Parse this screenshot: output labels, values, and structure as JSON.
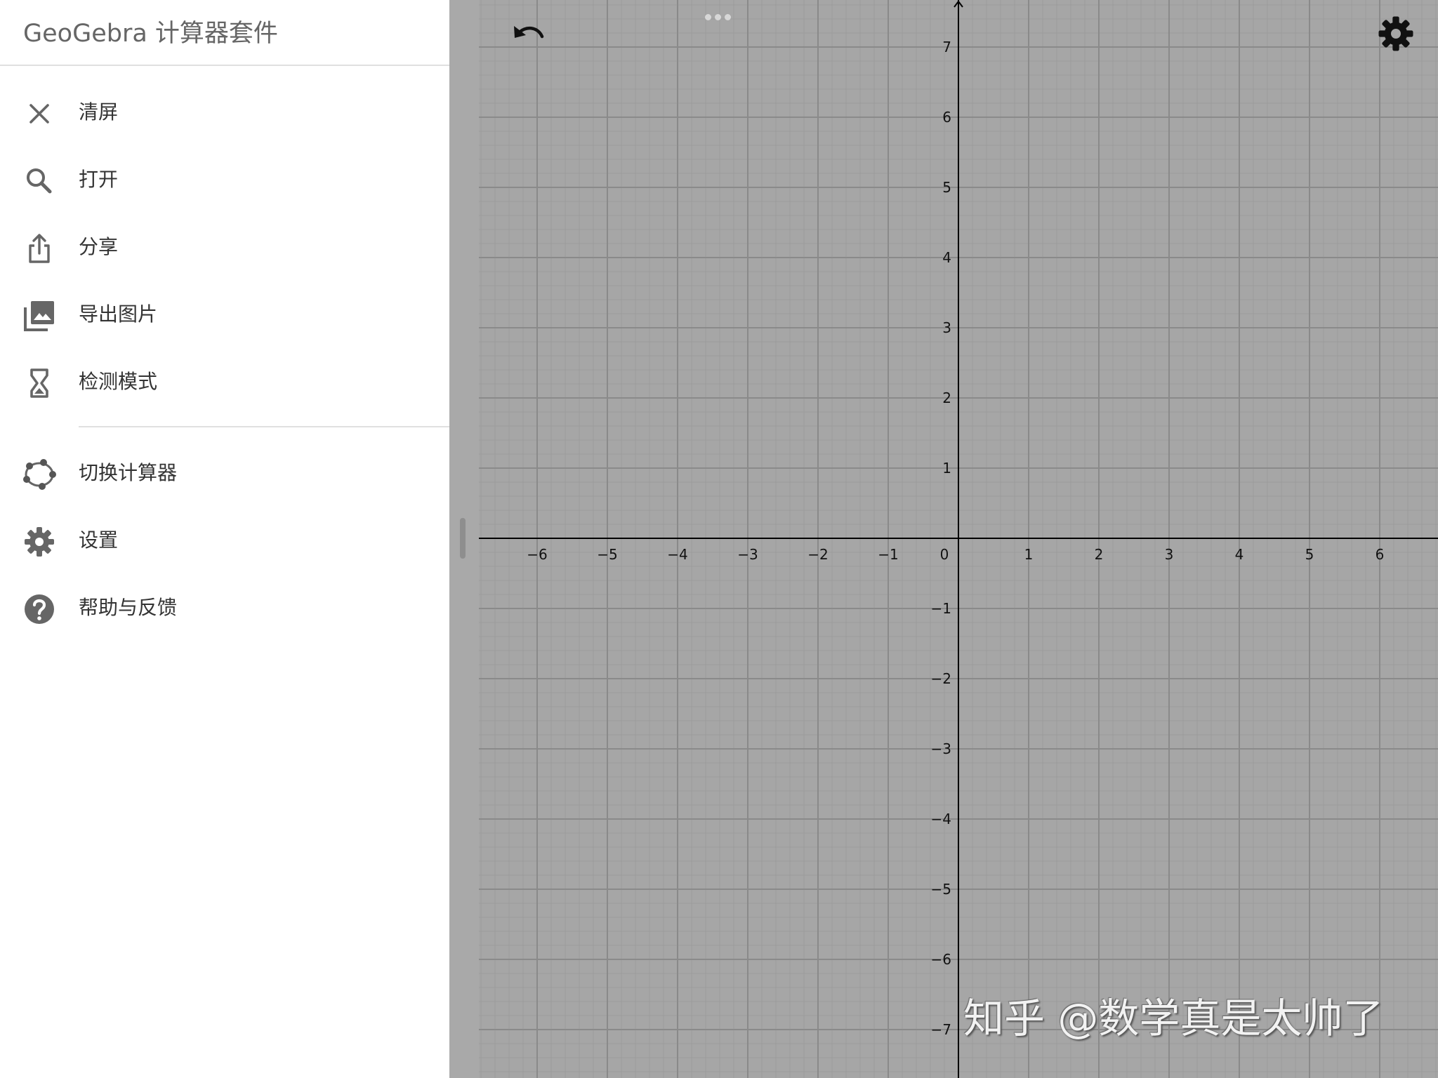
{
  "drawer": {
    "title": "GeoGebra 计算器套件",
    "items": [
      {
        "label": "清屏",
        "icon": "close-icon"
      },
      {
        "label": "打开",
        "icon": "search-icon"
      },
      {
        "label": "分享",
        "icon": "share-icon"
      },
      {
        "label": "导出图片",
        "icon": "image-export-icon"
      },
      {
        "label": "检测模式",
        "icon": "hourglass-icon"
      },
      {
        "label": "切换计算器",
        "icon": "geogebra-logo-icon"
      },
      {
        "label": "设置",
        "icon": "gear-icon"
      },
      {
        "label": "帮助与反馈",
        "icon": "help-icon"
      }
    ]
  },
  "graphics": {
    "axes": {
      "x_ticks": [
        "−6",
        "−5",
        "−4",
        "−3",
        "−2",
        "−1",
        "0",
        "1",
        "2",
        "3",
        "4",
        "5",
        "6"
      ],
      "y_ticks": [
        "7",
        "6",
        "5",
        "4",
        "3",
        "2",
        "1",
        "−1",
        "−2",
        "−3",
        "−4",
        "−5",
        "−6",
        "−7"
      ]
    },
    "toolbar": {
      "undo_icon": "undo-icon",
      "settings_icon": "gear-icon"
    }
  },
  "watermark": "知乎 @数学真是太帅了",
  "colors": {
    "drawer_bg": "#ffffff",
    "graphics_bg": "#a6a6a6",
    "grid_major": "#8a8a8a",
    "grid_minor": "#9c9c9c",
    "axis": "#000000",
    "menu_text": "#333333",
    "menu_icon": "#666666"
  }
}
